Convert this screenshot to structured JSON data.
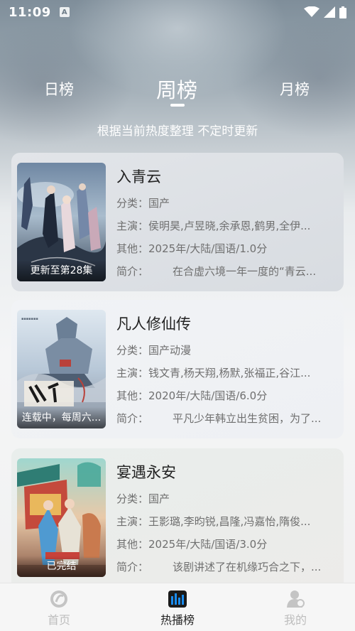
{
  "status_bar": {
    "time": "11:09",
    "notification_glyph": "A"
  },
  "tabs": {
    "day": "日榜",
    "week": "周榜",
    "month": "月榜",
    "active": "week"
  },
  "subtitle": "根据当前热度整理 不定时更新",
  "labels": {
    "category": "分类：",
    "cast": "主演：",
    "other": "其他：",
    "intro": "简介："
  },
  "shows": [
    {
      "title": "入青云",
      "category": "国产",
      "cast": "侯明昊,卢昱晓,余承恩,鹤男,全伊...",
      "other": "2025年/大陆/国语/1.0分",
      "intro": "在合虚六境一年一度的“青云...",
      "poster_label": "更新至第28集"
    },
    {
      "title": "凡人修仙传",
      "category": "国产动漫",
      "cast": "钱文青,杨天翔,杨默,张福正,谷江...",
      "other": "2020年/大陆/国语/6.0分",
      "intro": "平凡少年韩立出生贫困，为了...",
      "poster_label": "连载中，每周六..."
    },
    {
      "title": "宴遇永安",
      "category": "国产",
      "cast": "王影璐,李昀锐,昌隆,冯嘉怡,隋俊...",
      "other": "2025年/大陆/国语/3.0分",
      "intro": "该剧讲述了在机缘巧合之下，...",
      "poster_label": "已完结"
    }
  ],
  "bottom_nav": {
    "home": "首页",
    "hot": "热播榜",
    "me": "我的",
    "active": "hot"
  },
  "colors": {
    "active_nav_icon": "#1a8cf0",
    "inactive_nav": "#bdbdbd"
  }
}
